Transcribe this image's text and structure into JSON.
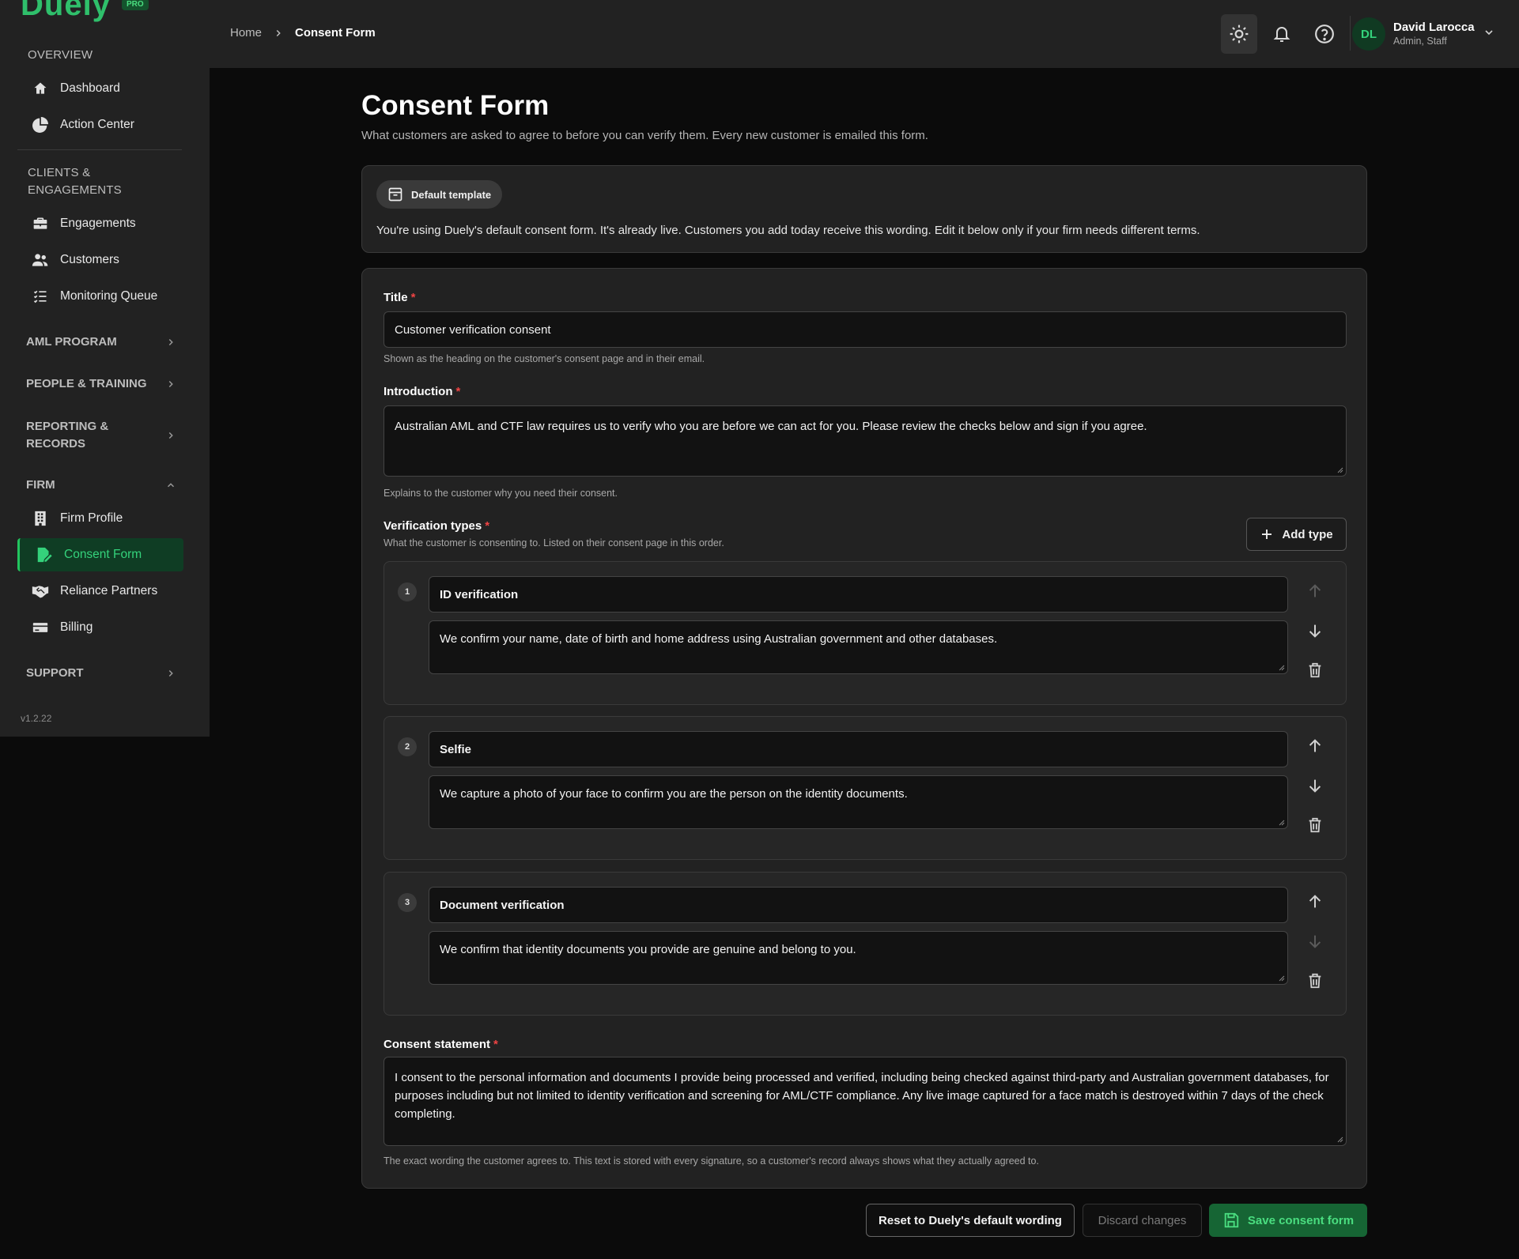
{
  "brand": {
    "logo_text": "Duely",
    "badge": "PRO"
  },
  "sidebar": {
    "overview_title": "OVERVIEW",
    "overview_items": [
      {
        "label": "Dashboard",
        "icon": "home-icon"
      },
      {
        "label": "Action Center",
        "icon": "pie-chart-icon"
      }
    ],
    "clients_title": "CLIENTS & ENGAGEMENTS",
    "clients_items": [
      {
        "label": "Engagements",
        "icon": "briefcase-icon"
      },
      {
        "label": "Customers",
        "icon": "users-icon"
      },
      {
        "label": "Monitoring Queue",
        "icon": "list-check-icon"
      }
    ],
    "aml_program": "AML PROGRAM",
    "people_training": "PEOPLE & TRAINING",
    "reporting_records": "REPORTING & RECORDS",
    "firm": "FIRM",
    "firm_items": [
      {
        "label": "Firm Profile",
        "icon": "building-icon"
      },
      {
        "label": "Consent Form",
        "icon": "document-edit-icon",
        "active": true
      },
      {
        "label": "Reliance Partners",
        "icon": "handshake-icon"
      },
      {
        "label": "Billing",
        "icon": "credit-card-icon"
      }
    ],
    "support": "SUPPORT",
    "version": "v1.2.22"
  },
  "topbar": {
    "breadcrumb_home": "Home",
    "breadcrumb_current": "Consent Form",
    "user_initials": "DL",
    "user_name": "David Larocca",
    "user_role": "Admin, Staff"
  },
  "page": {
    "title": "Consent Form",
    "subtitle": "What customers are asked to agree to before you can verify them. Every new customer is emailed this form."
  },
  "template_banner": {
    "badge": "Default template",
    "text": "You're using Duely's default consent form. It's already live. Customers you add today receive this wording. Edit it below only if your firm needs different terms."
  },
  "form": {
    "title_label": "Title",
    "title_value": "Customer verification consent",
    "title_help": "Shown as the heading on the customer's consent page and in their email.",
    "intro_label": "Introduction",
    "intro_value": "Australian AML and CTF law requires us to verify who you are before we can act for you. Please review the checks below and sign if you agree.",
    "intro_help": "Explains to the customer why you need their consent.",
    "vt_label": "Verification types",
    "vt_help": "What the customer is consenting to. Listed on their consent page in this order.",
    "add_type_label": "Add type",
    "verification_types": [
      {
        "num": "1",
        "name": "ID verification",
        "desc": "We confirm your name, date of birth and home address using Australian government and other databases."
      },
      {
        "num": "2",
        "name": "Selfie",
        "desc": "We capture a photo of your face to confirm you are the person on the identity documents."
      },
      {
        "num": "3",
        "name": "Document verification",
        "desc": "We confirm that identity documents you provide are genuine and belong to you."
      }
    ],
    "consent_label": "Consent statement",
    "consent_value": "I consent to the personal information and documents I provide being processed and verified, including being checked against third-party and Australian government databases, for purposes including but not limited to identity verification and screening for AML/CTF compliance. Any live image captured for a face match is destroyed within 7 days of the check completing.",
    "consent_help": "The exact wording the customer agrees to. This text is stored with every signature, so a customer's record always shows what they actually agreed to.",
    "required_mark": "*"
  },
  "actions": {
    "reset": "Reset to Duely's default wording",
    "discard": "Discard changes",
    "save": "Save consent form"
  },
  "colors": {
    "accent": "#22c55e",
    "danger": "#ef4444"
  }
}
